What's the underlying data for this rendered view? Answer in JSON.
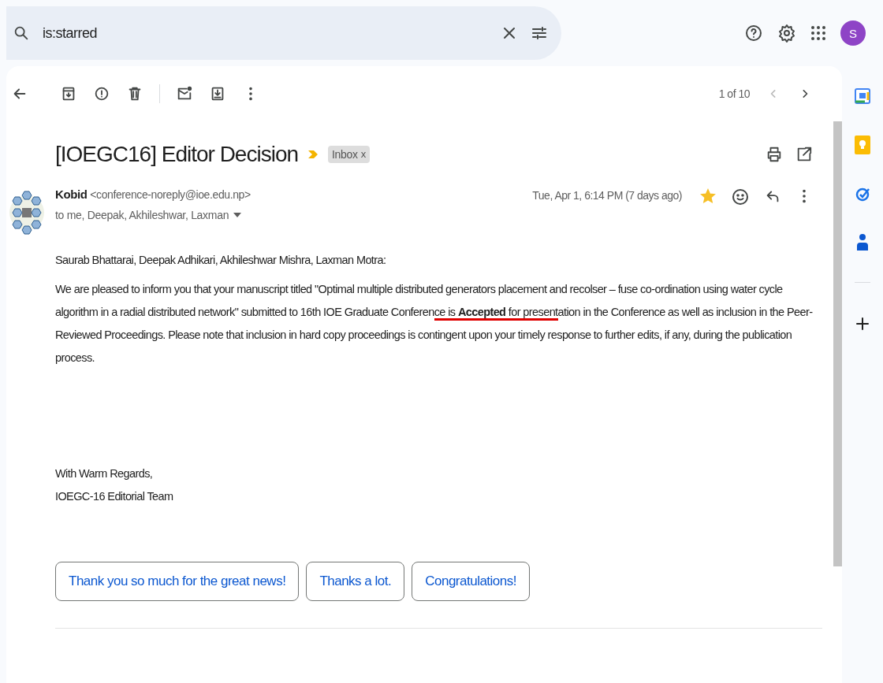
{
  "search": {
    "value": "is:starred"
  },
  "account": {
    "initial": "S"
  },
  "toolbar": {
    "pager": "1 of 10"
  },
  "message": {
    "subject": "[IOEGC16] Editor Decision",
    "label": "Inbox",
    "label_remove": "x",
    "important": true,
    "sender_name": "Kobid",
    "sender_email": "<conference-noreply@ioe.edu.np>",
    "recipients": "to me, Deepak, Akhileshwar, Laxman",
    "date": "Tue, Apr 1, 6:14 PM (7 days ago)",
    "starred": true
  },
  "body": {
    "greeting": "Saurab Bhattarai, Deepak Adhikari, Akhileshwar Mishra, Laxman Motra:",
    "paragraph": [
      {
        "text": "We are pleased to inform you that your manuscript titled \"Optimal multiple distributed generators placement and recolser – fuse co-ordination using water cycle algorithm in a radial distributed network\" submitted to 16th IOE Graduate Conferen",
        "underlined": false
      },
      {
        "text": "ce is **Accepted** for present",
        "underlined": true
      },
      {
        "text": "ation in the Conference as well as inclusion in the Peer-Reviewed Proceedings. Please note that inclusion in hard copy proceedings is contingent upon your timely response to further edits, if any, during the publication process.",
        "underlined": false
      }
    ],
    "closing": [
      "With Warm Regards,",
      "IOEGC-16 Editorial Team"
    ]
  },
  "smart_replies": [
    "Thank you so much for the great news!",
    "Thanks a lot.",
    "Congratulations!"
  ]
}
